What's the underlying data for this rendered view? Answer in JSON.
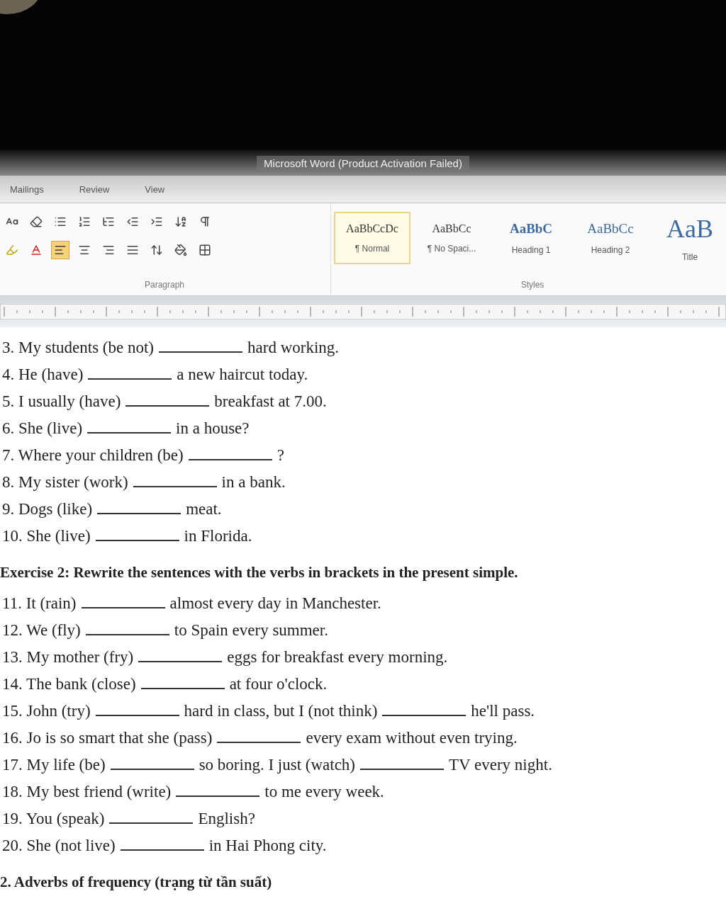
{
  "window": {
    "title": "Microsoft Word (Product Activation Failed)"
  },
  "tabs": [
    {
      "label": "Mailings",
      "selected": false
    },
    {
      "label": "Review",
      "selected": false
    },
    {
      "label": "View",
      "selected": false
    }
  ],
  "ribbon": {
    "paragraph_group": {
      "label": "Paragraph",
      "row_1": [
        {
          "kind": "font-size",
          "selected": false
        },
        {
          "kind": "clear-format",
          "selected": false
        },
        {
          "kind": "bullets",
          "selected": false
        },
        {
          "kind": "numbering",
          "selected": false
        },
        {
          "kind": "multilevel",
          "selected": false
        },
        {
          "kind": "outdent",
          "selected": false
        },
        {
          "kind": "indent",
          "selected": false
        },
        {
          "kind": "sort",
          "selected": false
        },
        {
          "kind": "pilcrow",
          "selected": false
        }
      ],
      "row_2": [
        {
          "kind": "highlight",
          "selected": false
        },
        {
          "kind": "font-color",
          "selected": false
        },
        {
          "kind": "align-left",
          "selected": true
        },
        {
          "kind": "align-center",
          "selected": false
        },
        {
          "kind": "align-right",
          "selected": false
        },
        {
          "kind": "justify",
          "selected": false
        },
        {
          "kind": "line-spacing",
          "selected": false
        },
        {
          "kind": "shading",
          "selected": false
        },
        {
          "kind": "borders",
          "selected": false
        }
      ]
    },
    "styles_group": {
      "label": "Styles",
      "styles": [
        {
          "sample": "AaBbCcDc",
          "name": "¶ Normal",
          "kind": "normal",
          "selected": true
        },
        {
          "sample": "AaBbCc",
          "name": "¶ No Spaci...",
          "kind": "normal",
          "selected": false
        },
        {
          "sample": "AaBbC",
          "name": "Heading 1",
          "kind": "heading",
          "selected": false
        },
        {
          "sample": "AaBbCc",
          "name": "Heading 2",
          "kind": "heading2",
          "selected": false
        },
        {
          "sample": "AaB",
          "name": "Title",
          "kind": "title",
          "selected": false
        }
      ]
    }
  },
  "document": {
    "exercise_1_items": [
      {
        "parts": [
          {
            "kind": "text",
            "text": "3. My students (be not)"
          },
          {
            "kind": "blank"
          },
          {
            "kind": "text",
            "text": "hard working."
          }
        ]
      },
      {
        "parts": [
          {
            "kind": "text",
            "text": "4. He (have)"
          },
          {
            "kind": "blank"
          },
          {
            "kind": "text",
            "text": "a new haircut today."
          }
        ]
      },
      {
        "parts": [
          {
            "kind": "text",
            "text": "5. I usually (have)"
          },
          {
            "kind": "blank"
          },
          {
            "kind": "text",
            "text": "breakfast at 7.00."
          }
        ]
      },
      {
        "parts": [
          {
            "kind": "text",
            "text": "6. She (live)"
          },
          {
            "kind": "blank"
          },
          {
            "kind": "text",
            "text": "in a house?"
          }
        ]
      },
      {
        "parts": [
          {
            "kind": "text",
            "text": "7. Where your children (be)"
          },
          {
            "kind": "blank"
          },
          {
            "kind": "text",
            "text": "?"
          }
        ]
      },
      {
        "parts": [
          {
            "kind": "text",
            "text": "8. My sister (work)"
          },
          {
            "kind": "blank"
          },
          {
            "kind": "text",
            "text": "in a bank."
          }
        ]
      },
      {
        "parts": [
          {
            "kind": "text",
            "text": "9. Dogs (like)"
          },
          {
            "kind": "blank"
          },
          {
            "kind": "text",
            "text": "meat."
          }
        ]
      },
      {
        "parts": [
          {
            "kind": "text",
            "text": "10. She (live)"
          },
          {
            "kind": "blank"
          },
          {
            "kind": "text",
            "text": "in Florida."
          }
        ]
      }
    ],
    "exercise_2_heading": "Exercise 2: Rewrite the sentences with the verbs in brackets in the present simple.",
    "exercise_2_items": [
      {
        "parts": [
          {
            "kind": "text",
            "text": "11. It (rain)"
          },
          {
            "kind": "blank"
          },
          {
            "kind": "text",
            "text": "almost every day in Manchester."
          }
        ]
      },
      {
        "parts": [
          {
            "kind": "text",
            "text": "12. We (fly)"
          },
          {
            "kind": "blank"
          },
          {
            "kind": "text",
            "text": "to Spain every summer."
          }
        ]
      },
      {
        "parts": [
          {
            "kind": "text",
            "text": "13. My mother (fry)"
          },
          {
            "kind": "blank"
          },
          {
            "kind": "text",
            "text": "eggs for breakfast every morning."
          }
        ]
      },
      {
        "parts": [
          {
            "kind": "text",
            "text": "14. The bank (close)"
          },
          {
            "kind": "blank"
          },
          {
            "kind": "text",
            "text": "at four o'clock."
          }
        ]
      },
      {
        "parts": [
          {
            "kind": "text",
            "text": "15. John (try)"
          },
          {
            "kind": "blank"
          },
          {
            "kind": "text",
            "text": "hard in class, but I (not think)"
          },
          {
            "kind": "blank"
          },
          {
            "kind": "text",
            "text": "he'll pass."
          }
        ]
      },
      {
        "parts": [
          {
            "kind": "text",
            "text": "16. Jo is so smart that she (pass)"
          },
          {
            "kind": "blank"
          },
          {
            "kind": "text",
            "text": "every exam without even trying."
          }
        ]
      },
      {
        "parts": [
          {
            "kind": "text",
            "text": "17. My life (be)"
          },
          {
            "kind": "blank"
          },
          {
            "kind": "text",
            "text": "so boring. I just (watch)"
          },
          {
            "kind": "blank"
          },
          {
            "kind": "text",
            "text": "TV every night."
          }
        ]
      },
      {
        "parts": [
          {
            "kind": "text",
            "text": "18. My best friend (write)"
          },
          {
            "kind": "blank"
          },
          {
            "kind": "text",
            "text": "to me every week."
          }
        ]
      },
      {
        "parts": [
          {
            "kind": "text",
            "text": "19. You (speak)"
          },
          {
            "kind": "blank"
          },
          {
            "kind": "text",
            "text": "English?"
          }
        ]
      },
      {
        "parts": [
          {
            "kind": "text",
            "text": "20. She (not live)"
          },
          {
            "kind": "blank"
          },
          {
            "kind": "text",
            "text": "in Hai Phong city."
          }
        ]
      }
    ],
    "section_heading": "2. Adverbs of frequency (trạng từ tần suất)"
  }
}
